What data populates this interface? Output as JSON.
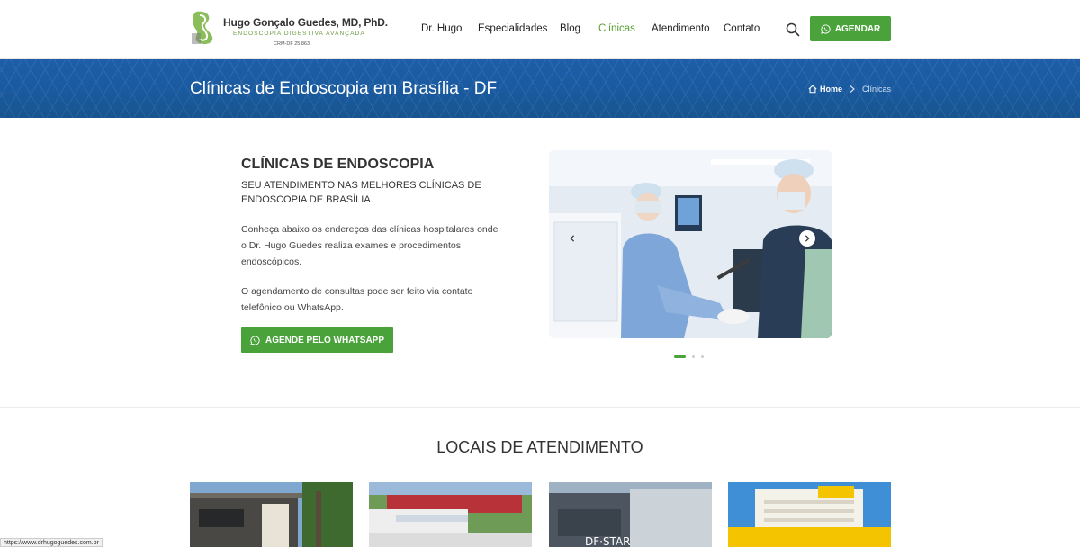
{
  "header": {
    "logo_name": "Hugo Gonçalo Guedes, MD, PhD.",
    "logo_sub": "ENDOSCOPIA DIGESTIVA AVANÇADA",
    "logo_crm": "CRM-DF 25.863",
    "nav": [
      {
        "label": "Dr. Hugo",
        "active": false
      },
      {
        "label": "Especialidades",
        "active": false
      },
      {
        "label": "Blog",
        "active": false
      },
      {
        "label": "Clínicas",
        "active": true
      },
      {
        "label": "Atendimento",
        "active": false
      },
      {
        "label": "Contato",
        "active": false
      }
    ],
    "cta_label": "AGENDAR"
  },
  "banner": {
    "title": "Clínicas de Endoscopia em Brasília - DF",
    "breadcrumb_home": "Home",
    "breadcrumb_current": "Clínicas"
  },
  "intro": {
    "title": "CLÍNICAS DE ENDOSCOPIA",
    "subtitle": "SEU ATENDIMENTO NAS MELHORES CLÍNICAS DE ENDOSCOPIA DE BRASÍLIA",
    "paragraph1": "Conheça abaixo os endereços das clínicas hospitalares onde o Dr. Hugo Guedes realiza exames e procedimentos endoscópicos.",
    "paragraph2": "O agendamento de consultas pode ser feito via contato telefônico ou WhatsApp.",
    "cta_label": "AGENDE PELO WHATSAPP"
  },
  "carousel": {
    "slide_count": 3,
    "active_slide": 1
  },
  "locais": {
    "title": "LOCAIS DE ATENDIMENTO"
  },
  "status_bar": {
    "url": "https://www.drhugoguedes.com.br"
  },
  "colors": {
    "accent_green": "#4aa23a",
    "banner_blue": "#1a5aa0",
    "active_nav": "#5a9e33"
  }
}
